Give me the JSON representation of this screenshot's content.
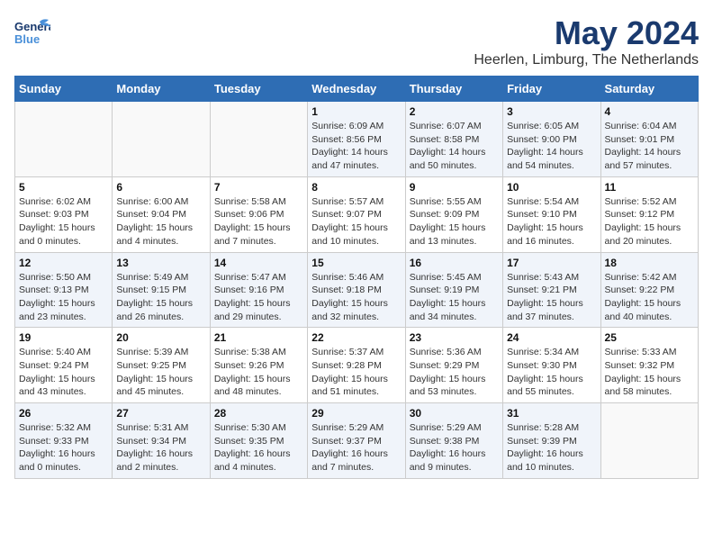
{
  "header": {
    "logo_general": "General",
    "logo_blue": "Blue",
    "title": "May 2024",
    "subtitle": "Heerlen, Limburg, The Netherlands"
  },
  "days_of_week": [
    "Sunday",
    "Monday",
    "Tuesday",
    "Wednesday",
    "Thursday",
    "Friday",
    "Saturday"
  ],
  "weeks": [
    [
      {
        "day": "",
        "info": ""
      },
      {
        "day": "",
        "info": ""
      },
      {
        "day": "",
        "info": ""
      },
      {
        "day": "1",
        "info": "Sunrise: 6:09 AM\nSunset: 8:56 PM\nDaylight: 14 hours\nand 47 minutes."
      },
      {
        "day": "2",
        "info": "Sunrise: 6:07 AM\nSunset: 8:58 PM\nDaylight: 14 hours\nand 50 minutes."
      },
      {
        "day": "3",
        "info": "Sunrise: 6:05 AM\nSunset: 9:00 PM\nDaylight: 14 hours\nand 54 minutes."
      },
      {
        "day": "4",
        "info": "Sunrise: 6:04 AM\nSunset: 9:01 PM\nDaylight: 14 hours\nand 57 minutes."
      }
    ],
    [
      {
        "day": "5",
        "info": "Sunrise: 6:02 AM\nSunset: 9:03 PM\nDaylight: 15 hours\nand 0 minutes."
      },
      {
        "day": "6",
        "info": "Sunrise: 6:00 AM\nSunset: 9:04 PM\nDaylight: 15 hours\nand 4 minutes."
      },
      {
        "day": "7",
        "info": "Sunrise: 5:58 AM\nSunset: 9:06 PM\nDaylight: 15 hours\nand 7 minutes."
      },
      {
        "day": "8",
        "info": "Sunrise: 5:57 AM\nSunset: 9:07 PM\nDaylight: 15 hours\nand 10 minutes."
      },
      {
        "day": "9",
        "info": "Sunrise: 5:55 AM\nSunset: 9:09 PM\nDaylight: 15 hours\nand 13 minutes."
      },
      {
        "day": "10",
        "info": "Sunrise: 5:54 AM\nSunset: 9:10 PM\nDaylight: 15 hours\nand 16 minutes."
      },
      {
        "day": "11",
        "info": "Sunrise: 5:52 AM\nSunset: 9:12 PM\nDaylight: 15 hours\nand 20 minutes."
      }
    ],
    [
      {
        "day": "12",
        "info": "Sunrise: 5:50 AM\nSunset: 9:13 PM\nDaylight: 15 hours\nand 23 minutes."
      },
      {
        "day": "13",
        "info": "Sunrise: 5:49 AM\nSunset: 9:15 PM\nDaylight: 15 hours\nand 26 minutes."
      },
      {
        "day": "14",
        "info": "Sunrise: 5:47 AM\nSunset: 9:16 PM\nDaylight: 15 hours\nand 29 minutes."
      },
      {
        "day": "15",
        "info": "Sunrise: 5:46 AM\nSunset: 9:18 PM\nDaylight: 15 hours\nand 32 minutes."
      },
      {
        "day": "16",
        "info": "Sunrise: 5:45 AM\nSunset: 9:19 PM\nDaylight: 15 hours\nand 34 minutes."
      },
      {
        "day": "17",
        "info": "Sunrise: 5:43 AM\nSunset: 9:21 PM\nDaylight: 15 hours\nand 37 minutes."
      },
      {
        "day": "18",
        "info": "Sunrise: 5:42 AM\nSunset: 9:22 PM\nDaylight: 15 hours\nand 40 minutes."
      }
    ],
    [
      {
        "day": "19",
        "info": "Sunrise: 5:40 AM\nSunset: 9:24 PM\nDaylight: 15 hours\nand 43 minutes."
      },
      {
        "day": "20",
        "info": "Sunrise: 5:39 AM\nSunset: 9:25 PM\nDaylight: 15 hours\nand 45 minutes."
      },
      {
        "day": "21",
        "info": "Sunrise: 5:38 AM\nSunset: 9:26 PM\nDaylight: 15 hours\nand 48 minutes."
      },
      {
        "day": "22",
        "info": "Sunrise: 5:37 AM\nSunset: 9:28 PM\nDaylight: 15 hours\nand 51 minutes."
      },
      {
        "day": "23",
        "info": "Sunrise: 5:36 AM\nSunset: 9:29 PM\nDaylight: 15 hours\nand 53 minutes."
      },
      {
        "day": "24",
        "info": "Sunrise: 5:34 AM\nSunset: 9:30 PM\nDaylight: 15 hours\nand 55 minutes."
      },
      {
        "day": "25",
        "info": "Sunrise: 5:33 AM\nSunset: 9:32 PM\nDaylight: 15 hours\nand 58 minutes."
      }
    ],
    [
      {
        "day": "26",
        "info": "Sunrise: 5:32 AM\nSunset: 9:33 PM\nDaylight: 16 hours\nand 0 minutes."
      },
      {
        "day": "27",
        "info": "Sunrise: 5:31 AM\nSunset: 9:34 PM\nDaylight: 16 hours\nand 2 minutes."
      },
      {
        "day": "28",
        "info": "Sunrise: 5:30 AM\nSunset: 9:35 PM\nDaylight: 16 hours\nand 4 minutes."
      },
      {
        "day": "29",
        "info": "Sunrise: 5:29 AM\nSunset: 9:37 PM\nDaylight: 16 hours\nand 7 minutes."
      },
      {
        "day": "30",
        "info": "Sunrise: 5:29 AM\nSunset: 9:38 PM\nDaylight: 16 hours\nand 9 minutes."
      },
      {
        "day": "31",
        "info": "Sunrise: 5:28 AM\nSunset: 9:39 PM\nDaylight: 16 hours\nand 10 minutes."
      },
      {
        "day": "",
        "info": ""
      }
    ]
  ]
}
